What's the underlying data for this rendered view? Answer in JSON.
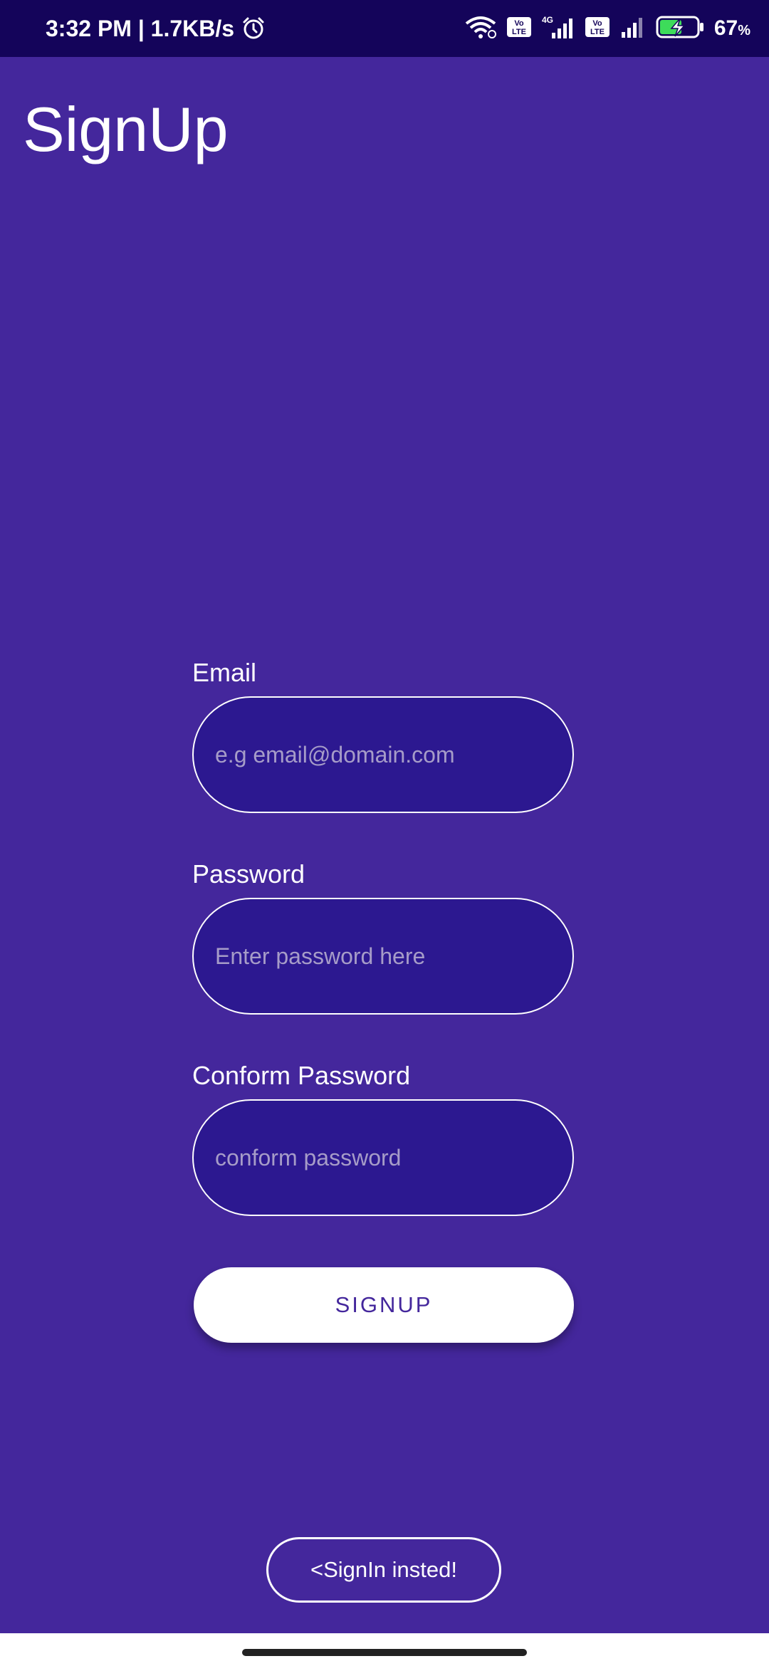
{
  "status_bar": {
    "time": "3:32 PM | 1.7KB/s",
    "battery": "67",
    "battery_unit": "%",
    "icons": [
      "alarm-icon",
      "wifi-icon",
      "volte-icon",
      "signal-4g-icon",
      "volte-icon",
      "signal-icon",
      "battery-charging-icon"
    ],
    "network_label": "4G",
    "volte_label": "Vo LTE"
  },
  "page": {
    "title": "SignUp"
  },
  "form": {
    "email": {
      "label": "Email",
      "placeholder": "e.g email@domain.com",
      "value": ""
    },
    "password": {
      "label": "Password",
      "placeholder": "Enter password here",
      "value": ""
    },
    "confirm_password": {
      "label": "Conform Password",
      "placeholder": "conform password",
      "value": ""
    },
    "signup_label": "SIGNUP"
  },
  "signin_link": "<SignIn insted!",
  "colors": {
    "background": "#44279c",
    "status_bar": "#14045a",
    "field_fill": "#2c1890",
    "accent_text": "#44279c"
  }
}
